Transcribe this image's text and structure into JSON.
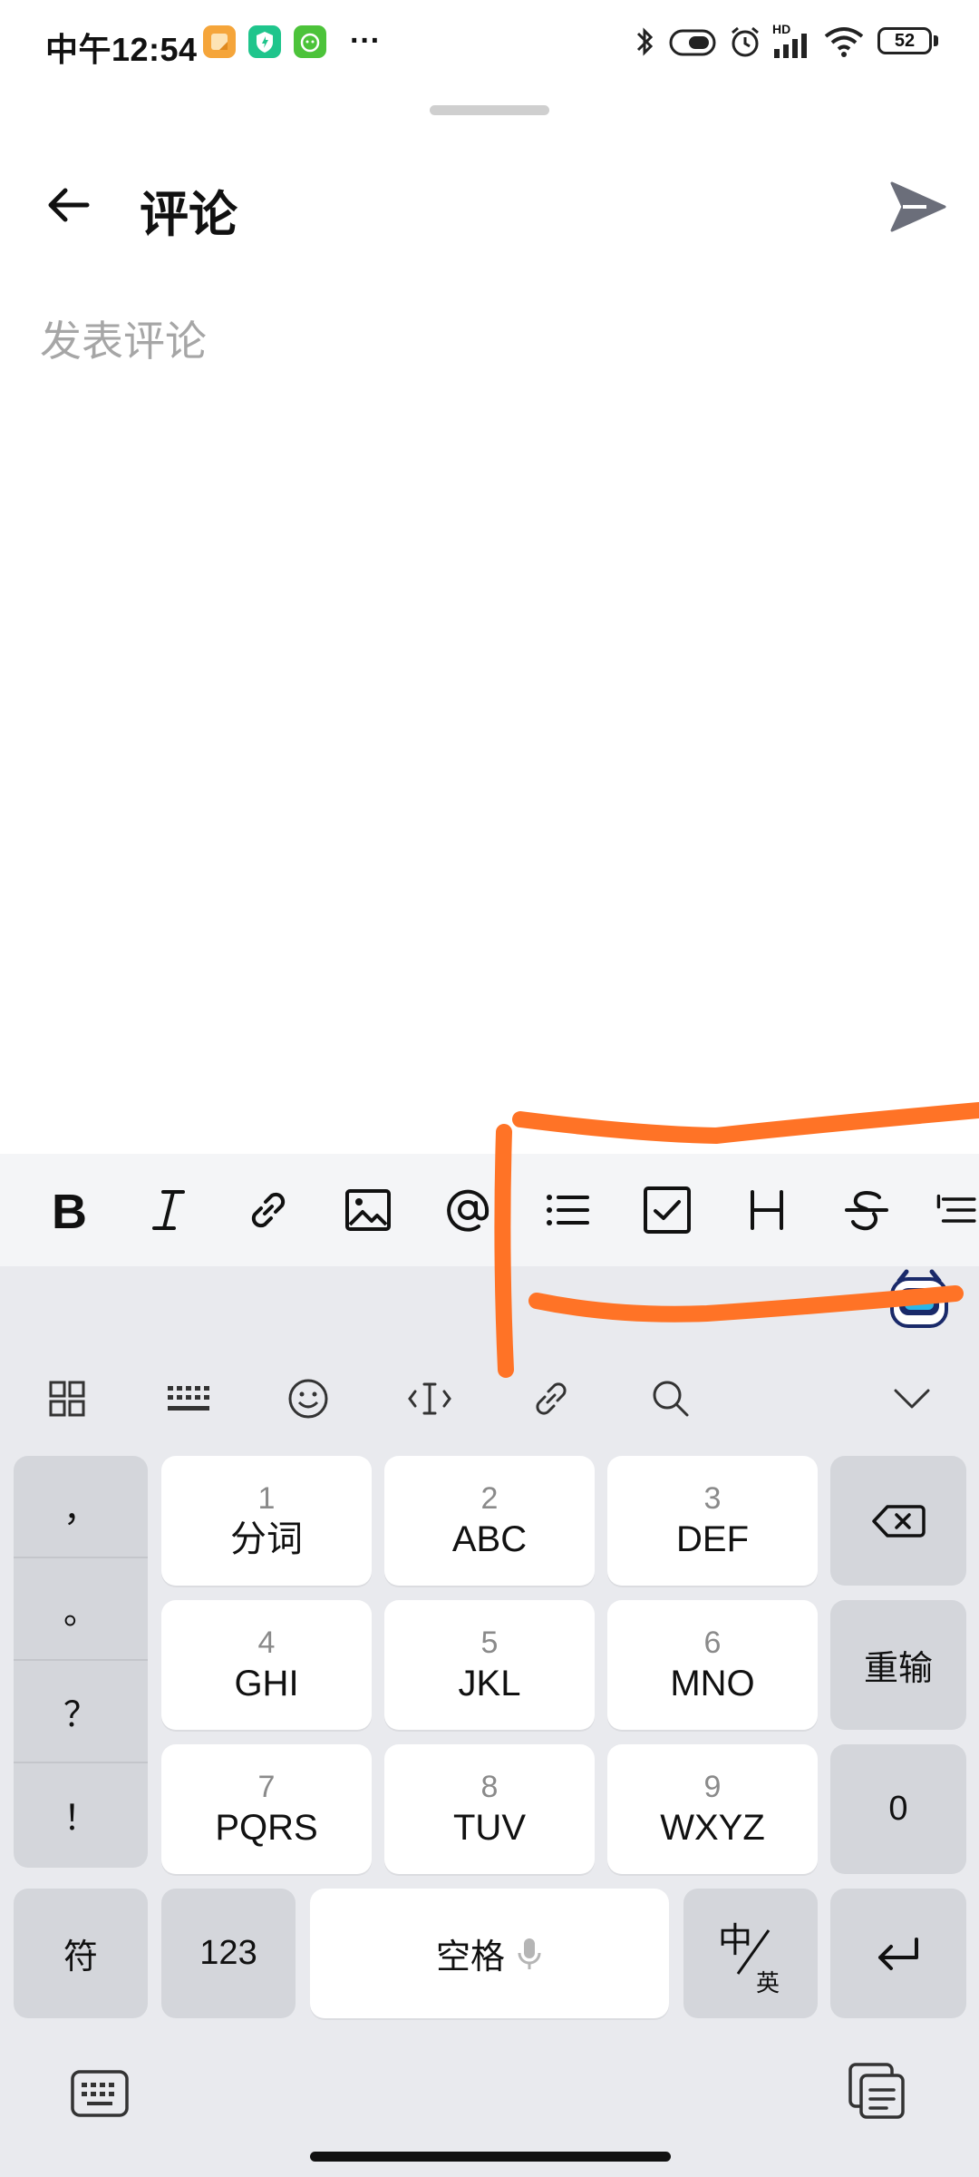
{
  "status_bar": {
    "time": "中午12:54",
    "battery": "52",
    "hd_label": "HD",
    "icons": [
      "app-notes-icon",
      "app-shield-icon",
      "app-wechat-mini-icon",
      "more-dots-icon",
      "bluetooth-icon",
      "toggle-icon",
      "alarm-icon",
      "signal-icon",
      "wifi-icon",
      "battery-icon"
    ]
  },
  "header": {
    "title": "评论",
    "back_icon": "arrow-left-icon",
    "send_icon": "send-icon"
  },
  "comment": {
    "placeholder": "发表评论",
    "value": ""
  },
  "format_toolbar": {
    "items": [
      "bold-icon",
      "italic-icon",
      "link-icon",
      "image-icon",
      "mention-icon",
      "bullet-list-icon",
      "checkbox-icon",
      "heading-icon",
      "strikethrough-icon",
      "indent-icon"
    ]
  },
  "keyboard": {
    "tools": [
      "grid-icon",
      "keyboard-icon",
      "emoji-icon",
      "cursor-icon",
      "link-icon",
      "search-icon",
      "collapse-icon"
    ],
    "punctuation": [
      "，",
      "。",
      "？",
      "！"
    ],
    "keys": [
      {
        "num": "1",
        "letters": "分词"
      },
      {
        "num": "2",
        "letters": "ABC"
      },
      {
        "num": "3",
        "letters": "DEF"
      },
      {
        "num": "4",
        "letters": "GHI"
      },
      {
        "num": "5",
        "letters": "JKL"
      },
      {
        "num": "6",
        "letters": "MNO"
      },
      {
        "num": "7",
        "letters": "PQRS"
      },
      {
        "num": "8",
        "letters": "TUV"
      },
      {
        "num": "9",
        "letters": "WXYZ"
      }
    ],
    "reinput": "重输",
    "zero": "0",
    "symbols": "符",
    "numbers": "123",
    "space": "空格",
    "lang_top": "中",
    "lang_bottom": "英"
  },
  "colors": {
    "scribble": "#ff7326",
    "placeholder": "#a6a6a6",
    "send": "#6b6e7a"
  }
}
